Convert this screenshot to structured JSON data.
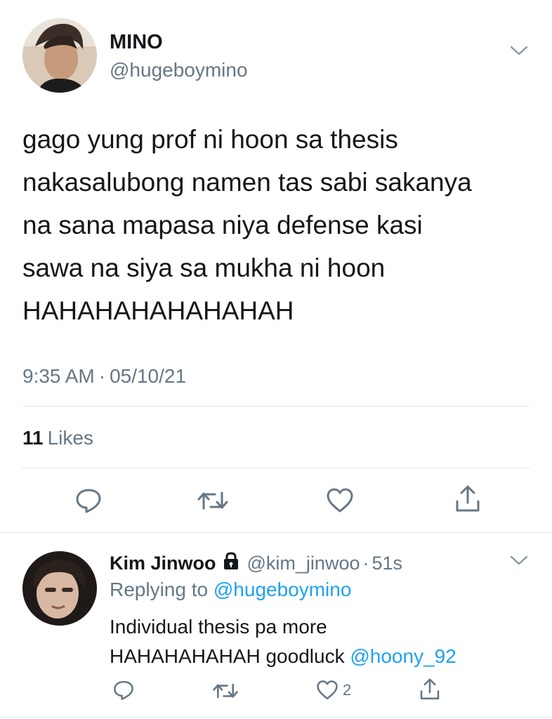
{
  "tweet": {
    "author_name": "MINO",
    "author_handle": "@hugeboymino",
    "text_lines": [
      "gago yung prof ni hoon sa thesis",
      "nakasalubong namen tas sabi sakanya",
      "na sana mapasa niya defense kasi",
      "sawa na siya sa mukha ni hoon",
      "HAHAHAHAHAHAHAH"
    ],
    "time": "9:35 AM",
    "separator": "·",
    "date": "05/10/21",
    "likes_count": "11",
    "likes_label": "Likes",
    "icons": {
      "menu": "chevron-down-icon",
      "reply": "reply-icon",
      "retweet": "retweet-icon",
      "like": "heart-icon",
      "share": "share-icon"
    }
  },
  "reply": {
    "author_name": "Kim Jinwoo",
    "author_handle": "@kim_jinwoo",
    "separator": "·",
    "time_ago": "51s",
    "replying_label": "Replying to",
    "replying_handle": "@hugeboymino",
    "text_line1": "Individual thesis pa more",
    "text_line2_prefix": "HAHAHAHAHAH goodluck",
    "text_line2_mention": "@hoony_92",
    "like_count": "2",
    "icons": {
      "lock": "lock-icon",
      "menu": "chevron-down-icon",
      "reply": "reply-icon",
      "retweet": "retweet-icon",
      "like": "heart-icon",
      "share": "share-icon"
    }
  },
  "colors": {
    "text": "#14171a",
    "secondary": "#657786",
    "link": "#1da1f2",
    "divider": "#e1e8ed"
  }
}
